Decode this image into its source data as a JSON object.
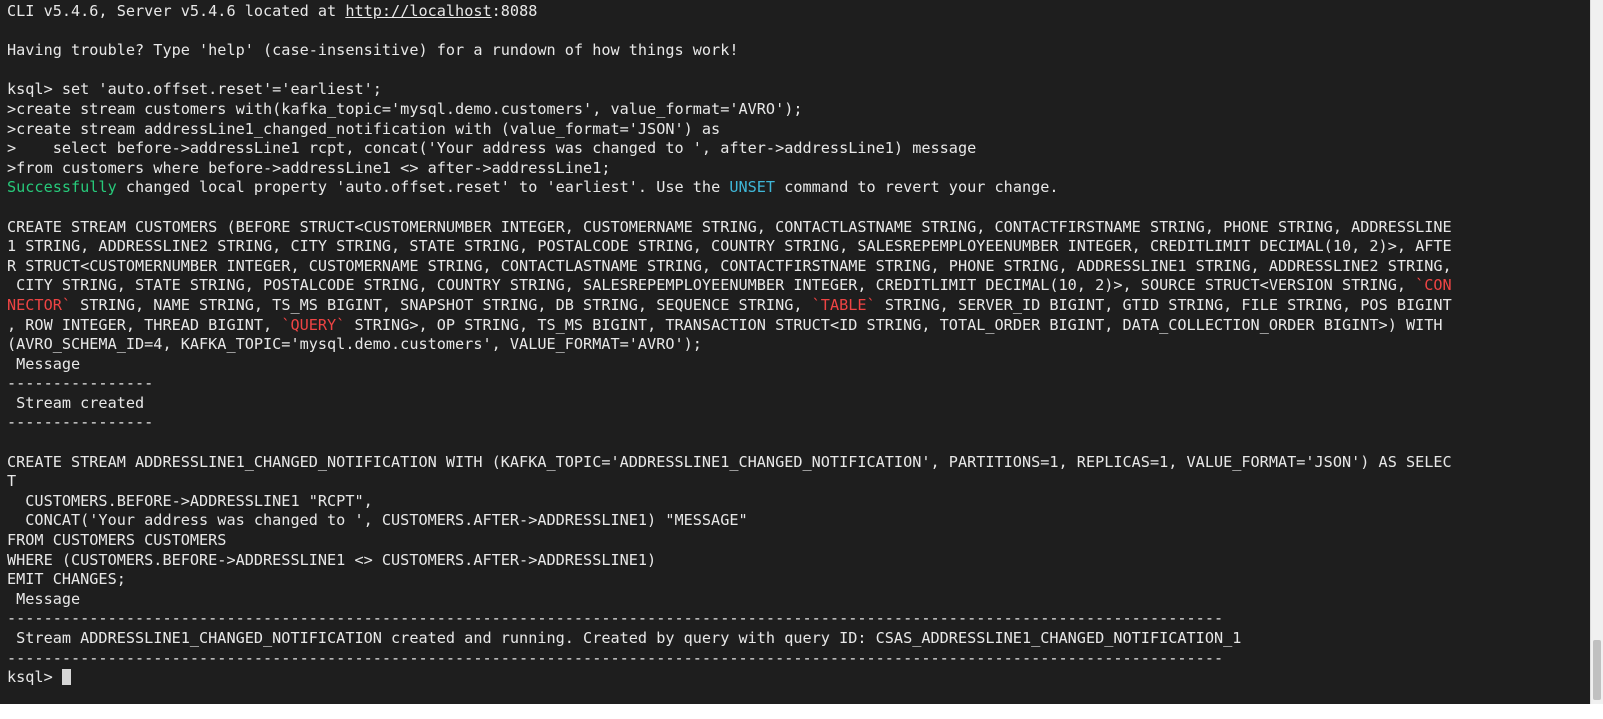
{
  "terminal": {
    "header": {
      "version_prefix": "CLI v5.4.6, Server v5.4.6 located at ",
      "server_url": "http://localhost",
      "server_port": ":8088"
    },
    "help_line": "Having trouble? Type 'help' (case-insensitive) for a rundown of how things work!",
    "commands": [
      "ksql> set 'auto.offset.reset'='earliest';",
      ">create stream customers with(kafka_topic='mysql.demo.customers', value_format='AVRO');",
      ">create stream addressLine1_changed_notification with (value_format='JSON') as",
      ">    select before->addressLine1 rcpt, concat('Your address was changed to ', after->addressLine1) message",
      ">from customers where before->addressLine1 <> after->addressLine1;"
    ],
    "property_msg": {
      "success_word": "Successfully",
      "text_a": " changed local property 'auto.offset.reset' to 'earliest'. Use the ",
      "unset_word": "UNSET",
      "text_b": " command to revert your change."
    },
    "create_customers": {
      "l1": "CREATE STREAM CUSTOMERS (BEFORE STRUCT<CUSTOMERNUMBER INTEGER, CUSTOMERNAME STRING, CONTACTLASTNAME STRING, CONTACTFIRSTNAME STRING, PHONE STRING, ADDRESSLINE",
      "l2": "1 STRING, ADDRESSLINE2 STRING, CITY STRING, STATE STRING, POSTALCODE STRING, COUNTRY STRING, SALESREPEMPLOYEENUMBER INTEGER, CREDITLIMIT DECIMAL(10, 2)>, AFTE",
      "l3": "R STRUCT<CUSTOMERNUMBER INTEGER, CUSTOMERNAME STRING, CONTACTLASTNAME STRING, CONTACTFIRSTNAME STRING, PHONE STRING, ADDRESSLINE1 STRING, ADDRESSLINE2 STRING,",
      "l4_a": " CITY STRING, STATE STRING, POSTALCODE STRING, COUNTRY STRING, SALESREPEMPLOYEENUMBER INTEGER, CREDITLIMIT DECIMAL(10, 2)>, SOURCE STRUCT<VERSION STRING, ",
      "l4_kw": "`CON",
      "l5_kw": "NECTOR`",
      "l5_a": " STRING, NAME STRING, TS_MS BIGINT, SNAPSHOT STRING, DB STRING, SEQUENCE STRING, ",
      "l5_kw2": "`TABLE`",
      "l5_b": " STRING, SERVER_ID BIGINT, GTID STRING, FILE STRING, POS BIGINT",
      "l6_a": ", ROW INTEGER, THREAD BIGINT, ",
      "l6_kw": "`QUERY`",
      "l6_b": " STRING>, OP STRING, TS_MS BIGINT, TRANSACTION STRUCT<ID STRING, TOTAL_ORDER BIGINT, DATA_COLLECTION_ORDER BIGINT>) WITH",
      "l7": "(AVRO_SCHEMA_ID=4, KAFKA_TOPIC='mysql.demo.customers', VALUE_FORMAT='AVRO');"
    },
    "result1": {
      "header": " Message",
      "divider": "----------------",
      "message": " Stream created",
      "divider2": "----------------"
    },
    "create_notification": {
      "l1": "CREATE STREAM ADDRESSLINE1_CHANGED_NOTIFICATION WITH (KAFKA_TOPIC='ADDRESSLINE1_CHANGED_NOTIFICATION', PARTITIONS=1, REPLICAS=1, VALUE_FORMAT='JSON') AS SELEC",
      "l2": "T",
      "l3": "  CUSTOMERS.BEFORE->ADDRESSLINE1 \"RCPT\",",
      "l4": "  CONCAT('Your address was changed to ', CUSTOMERS.AFTER->ADDRESSLINE1) \"MESSAGE\"",
      "l5": "FROM CUSTOMERS CUSTOMERS",
      "l6": "WHERE (CUSTOMERS.BEFORE->ADDRESSLINE1 <> CUSTOMERS.AFTER->ADDRESSLINE1)",
      "l7": "EMIT CHANGES;"
    },
    "result2": {
      "header": " Message",
      "divider": "-------------------------------------------------------------------------------------------------------------------------------------",
      "message": " Stream ADDRESSLINE1_CHANGED_NOTIFICATION created and running. Created by query with query ID: CSAS_ADDRESSLINE1_CHANGED_NOTIFICATION_1",
      "divider2": "-------------------------------------------------------------------------------------------------------------------------------------"
    },
    "prompt": "ksql> ",
    "colors": {
      "background": "#1e1e1e",
      "text": "#e8e8e8",
      "success": "#27c97a",
      "keyword_cyan": "#3fb7d8",
      "quoted_identifier": "#ee4444"
    }
  }
}
